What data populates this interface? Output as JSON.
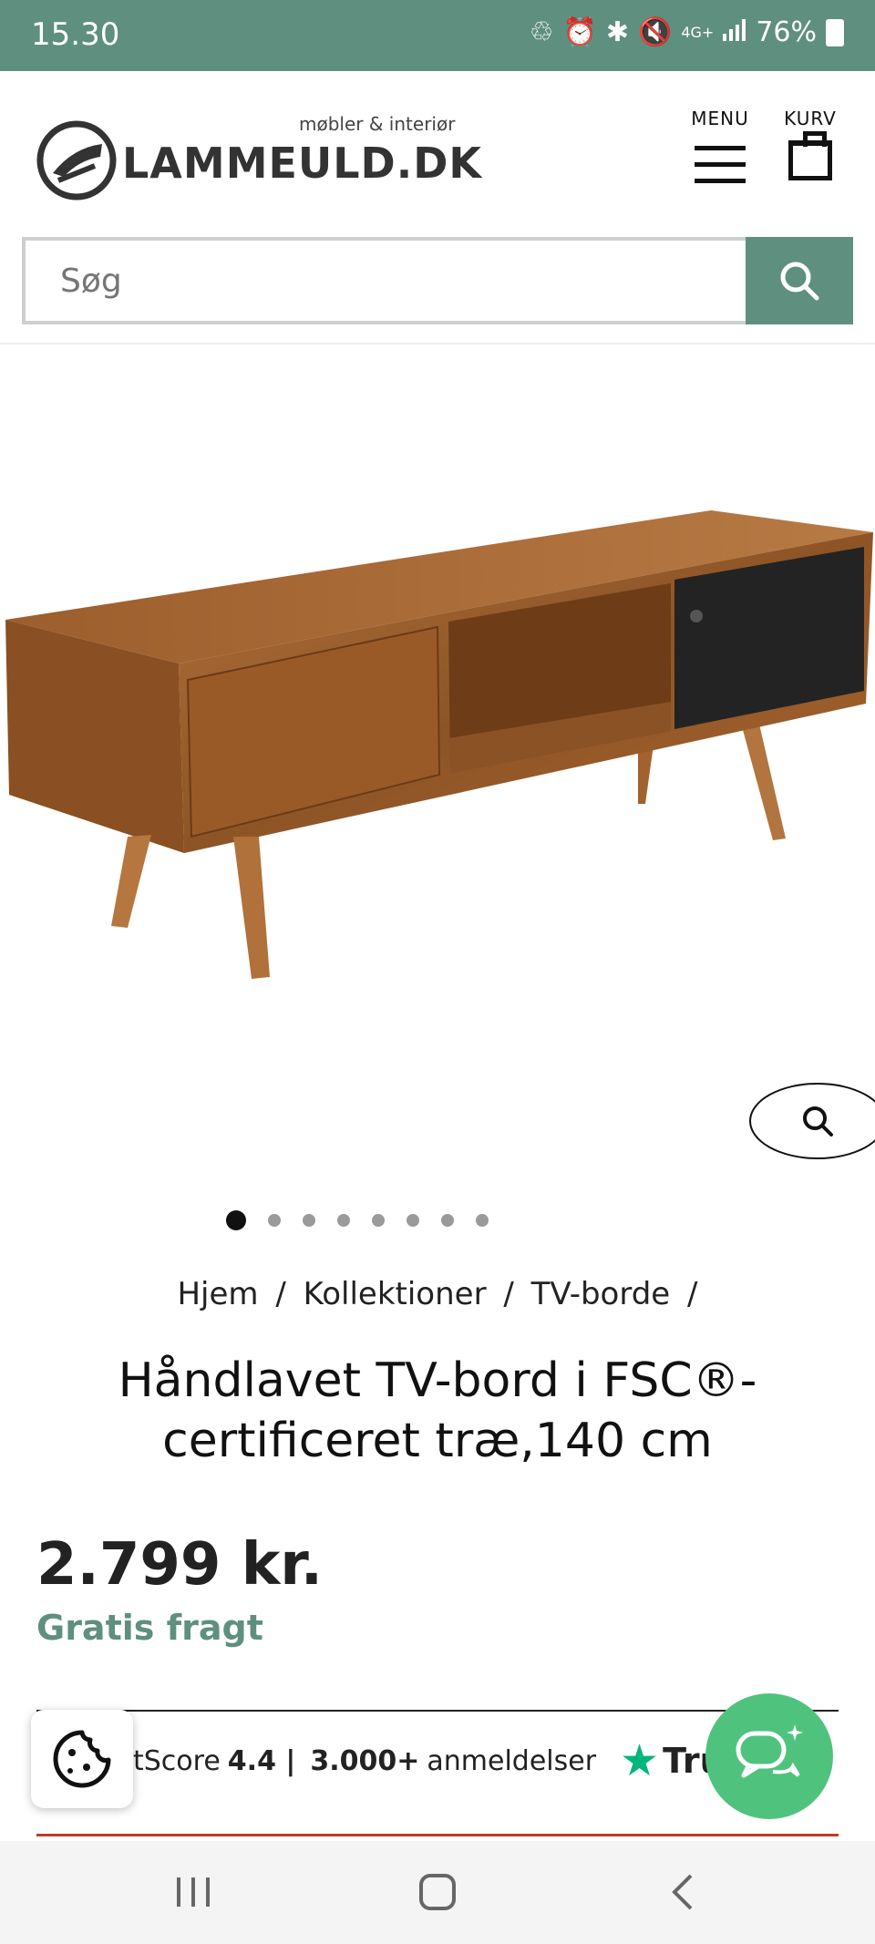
{
  "status_bar": {
    "time": "15.30",
    "network": "4G+",
    "battery": "76%"
  },
  "header": {
    "logo_text": "LAMMEULD.DK",
    "logo_tagline": "møbler & interiør",
    "menu_label": "MENU",
    "cart_label": "KURV"
  },
  "search": {
    "placeholder": "Søg"
  },
  "gallery": {
    "image_count": 8,
    "active_index": 1
  },
  "breadcrumb": {
    "items": [
      "Hjem",
      "Kollektioner",
      "TV-borde"
    ],
    "separator": "/"
  },
  "product": {
    "title": "Håndlavet TV-bord i FSC®-certificeret træ,140 cm",
    "price": "2.799 kr.",
    "shipping": "Gratis fragt"
  },
  "trustpilot": {
    "score_prefix": "tScore",
    "score": "4.4 |",
    "reviews_count": "3.000+",
    "reviews_label": "anmeldelser",
    "brand": "Tru"
  },
  "colors": {
    "brand_green": "#5f8f7e",
    "chat_green": "#4fc37e",
    "trust_green": "#00b67a"
  },
  "icons": {
    "search": "search-icon",
    "zoom": "zoom-icon",
    "cookie": "cookie-icon",
    "chat": "chat-icon"
  }
}
